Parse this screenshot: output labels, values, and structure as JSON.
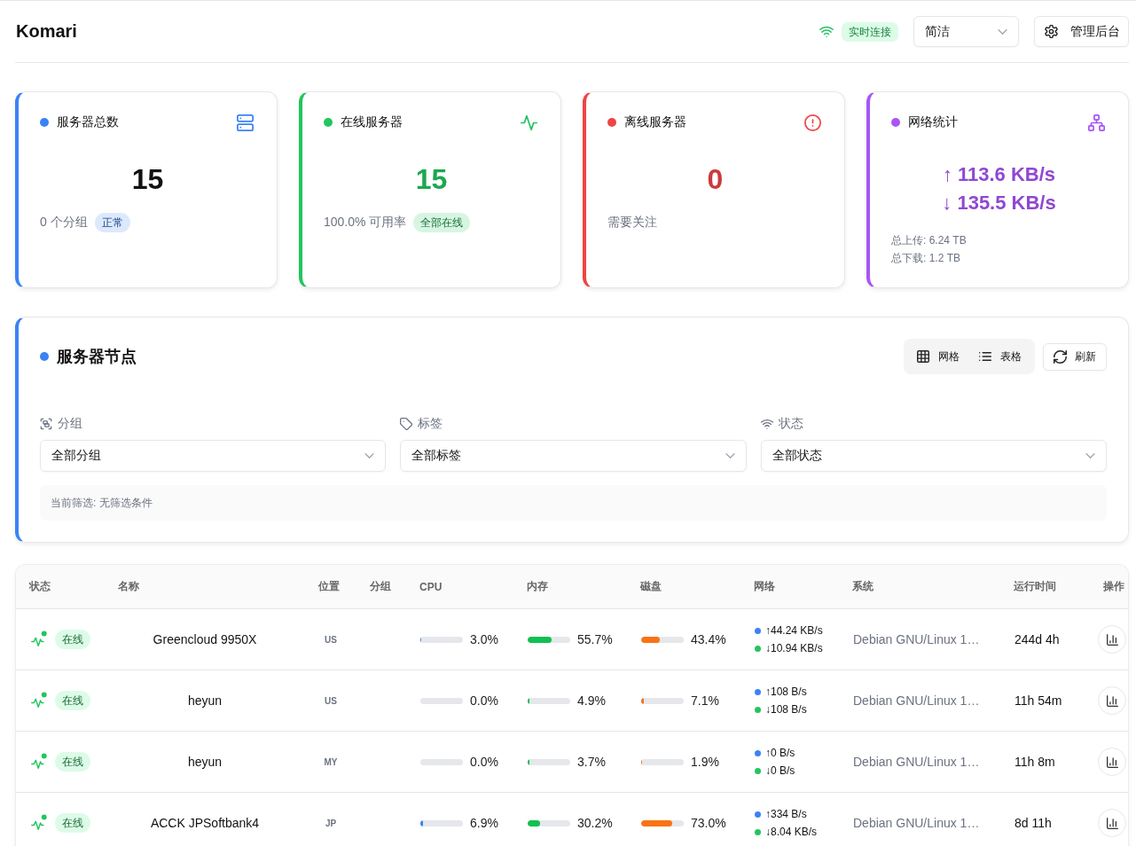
{
  "header": {
    "title": "Komari",
    "connection_badge": "实时连接",
    "view_select": {
      "value": "简洁"
    },
    "admin_button": "管理后台"
  },
  "stat_cards": [
    {
      "kind": "total",
      "title": "服务器总数",
      "color": "#3b82f6",
      "value": "15",
      "subtitle": "0 个分组",
      "badge": "正常"
    },
    {
      "kind": "online",
      "title": "在线服务器",
      "color": "#22c55e",
      "value": "15",
      "subtitle": "100.0% 可用率",
      "badge": "全部在线"
    },
    {
      "kind": "offline",
      "title": "离线服务器",
      "color": "#ef4444",
      "value": "0",
      "subtitle": "需要关注"
    },
    {
      "kind": "network",
      "title": "网络统计",
      "color": "#a855f7",
      "upload_speed": "↑ 113.6 KB/s",
      "download_speed": "↓ 135.5 KB/s",
      "total_upload": "总上传: 6.24 TB",
      "total_download": "总下载: 1.2 TB"
    }
  ],
  "nodes_panel": {
    "title": "服务器节点",
    "view_toggle": [
      "网格",
      "表格"
    ],
    "refresh_button": "刷新",
    "filters": [
      {
        "label": "分组",
        "value": "全部分组"
      },
      {
        "label": "标签",
        "value": "全部标签"
      },
      {
        "label": "状态",
        "value": "全部状态"
      }
    ],
    "current_filter": "当前筛选: 无筛选条件"
  },
  "table": {
    "columns": [
      "状态",
      "名称",
      "位置",
      "分组",
      "CPU",
      "内存",
      "磁盘",
      "网络",
      "系统",
      "运行时间",
      "操作"
    ],
    "rows": [
      {
        "status": "在线",
        "online": true,
        "name": "Greencloud 9950X",
        "location": "US",
        "cpu": {
          "level": 0.03,
          "reading": "3.0%"
        },
        "memory": {
          "level": 0.557,
          "reading": "55.7%"
        },
        "disk": {
          "level": 0.434,
          "reading": "43.4%"
        },
        "upload": "↑44.24 KB/s",
        "download": "↓10.94 KB/s",
        "system": "Debian GNU/Linux 1…",
        "uptime": "244d 4h"
      },
      {
        "status": "在线",
        "online": true,
        "name": "heyun",
        "location": "US",
        "cpu": {
          "level": 0,
          "reading": "0.0%"
        },
        "memory": {
          "level": 0.049,
          "reading": "4.9%"
        },
        "disk": {
          "level": 0.071,
          "reading": "7.1%"
        },
        "upload": "↑108 B/s",
        "download": "↓108 B/s",
        "system": "Debian GNU/Linux 1…",
        "uptime": "11h 54m"
      },
      {
        "status": "在线",
        "online": true,
        "name": "heyun",
        "location": "MY",
        "cpu": {
          "level": 0,
          "reading": "0.0%"
        },
        "memory": {
          "level": 0.037,
          "reading": "3.7%"
        },
        "disk": {
          "level": 0.019,
          "reading": "1.9%"
        },
        "upload": "↑0 B/s",
        "download": "↓0 B/s",
        "system": "Debian GNU/Linux 1…",
        "uptime": "11h 8m"
      },
      {
        "status": "在线",
        "online": true,
        "name": "ACCK JPSoftbank4",
        "location": "JP",
        "cpu": {
          "level": 0.069,
          "reading": "6.9%"
        },
        "memory": {
          "level": 0.302,
          "reading": "30.2%"
        },
        "disk": {
          "level": 0.73,
          "reading": "73.0%"
        },
        "upload": "↑334 B/s",
        "download": "↓8.04 KB/s",
        "system": "Debian GNU/Linux 1…",
        "uptime": "8d 11h"
      }
    ]
  }
}
